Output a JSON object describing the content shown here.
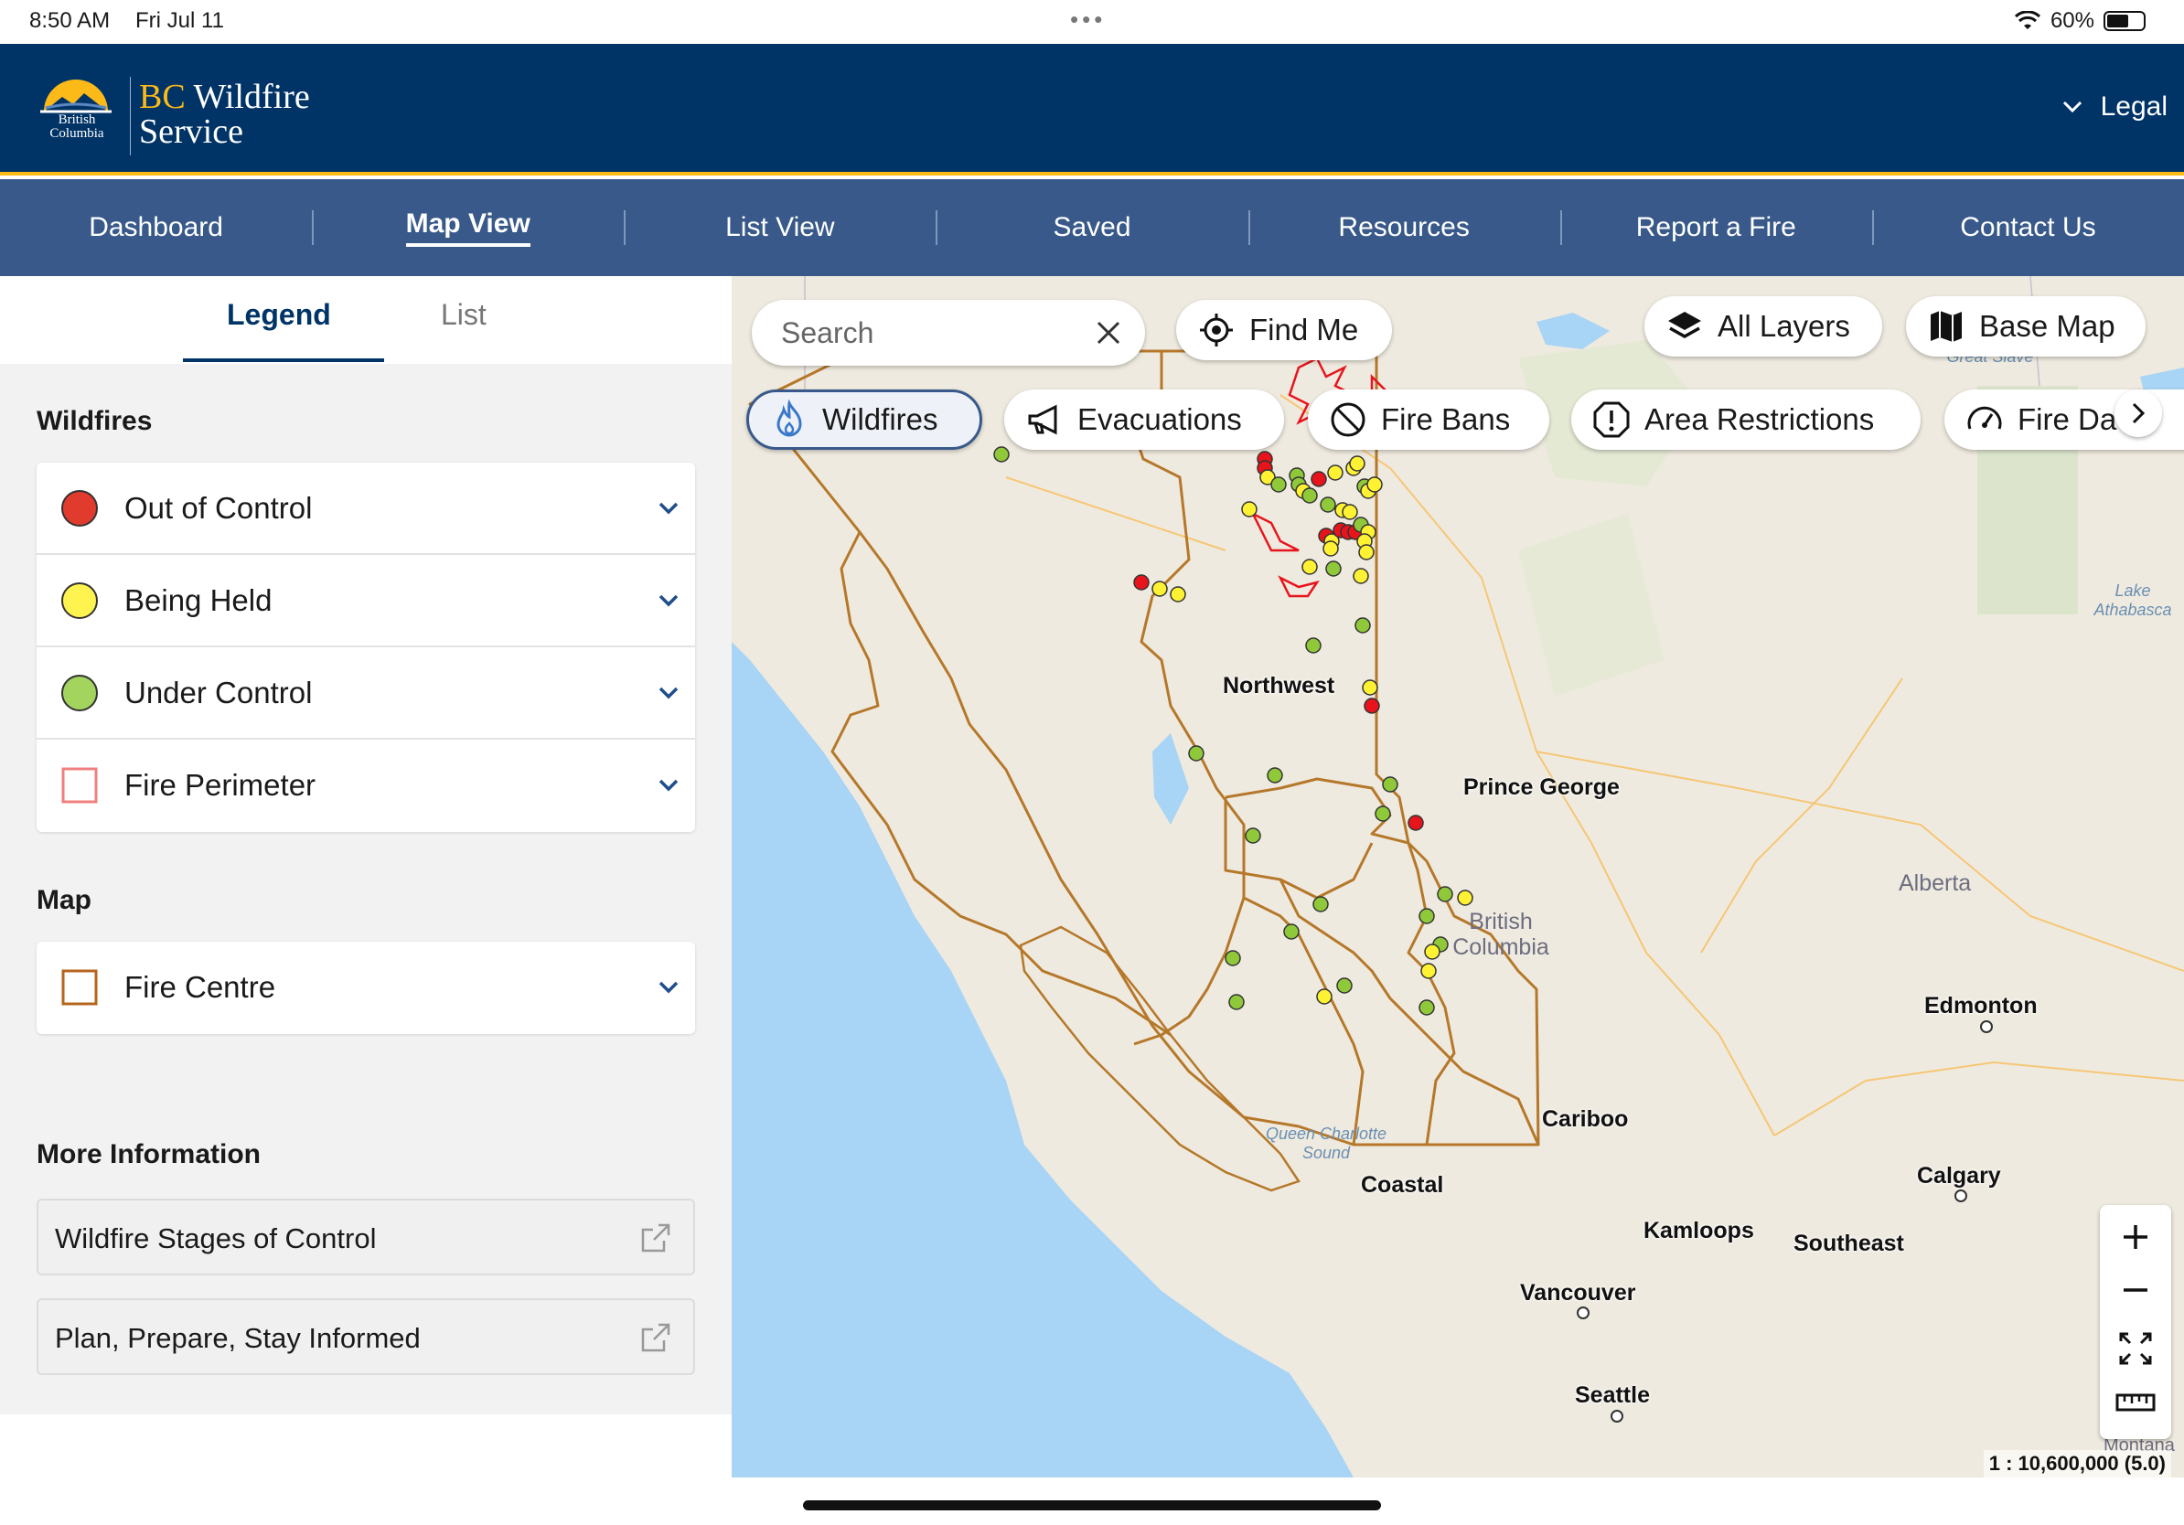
{
  "status_bar": {
    "time": "8:50 AM",
    "date": "Fri Jul 11",
    "battery": "60%",
    "battery_level": 0.6
  },
  "header": {
    "logo_small": "British Columbia",
    "logo_bc": "BC",
    "logo_title_rest": "Wildfire",
    "logo_title_line2": "Service",
    "legal_label": "Legal"
  },
  "nav": {
    "items": [
      "Dashboard",
      "Map View",
      "List View",
      "Saved",
      "Resources",
      "Report a Fire",
      "Contact Us"
    ],
    "active_index": 1
  },
  "panel": {
    "tabs": [
      "Legend",
      "List"
    ],
    "active_tab": 0,
    "wildfires_heading": "Wildfires",
    "wildfire_legend": [
      {
        "label": "Out of Control",
        "color": "#e03b2c",
        "symbol": "circle"
      },
      {
        "label": "Being Held",
        "color": "#fff44f",
        "symbol": "circle"
      },
      {
        "label": "Under Control",
        "color": "#a2d45e",
        "symbol": "circle"
      },
      {
        "label": "Fire Perimeter",
        "color": "#f08080",
        "symbol": "square-outline"
      }
    ],
    "map_heading": "Map",
    "map_legend": [
      {
        "label": "Fire Centre",
        "color": "#b5651d",
        "symbol": "square-outline"
      }
    ],
    "more_info_heading": "More Information",
    "more_info_links": [
      "Wildfire Stages of Control",
      "Plan, Prepare, Stay Informed"
    ]
  },
  "map": {
    "search_placeholder": "Search",
    "find_me": "Find Me",
    "all_layers": "All Layers",
    "base_map": "Base Map",
    "filters": [
      {
        "label": "Wildfires",
        "icon": "flame-icon",
        "active": true
      },
      {
        "label": "Evacuations",
        "icon": "megaphone-icon",
        "active": false
      },
      {
        "label": "Fire Bans",
        "icon": "ban-icon",
        "active": false
      },
      {
        "label": "Area Restrictions",
        "icon": "alert-icon",
        "active": false
      },
      {
        "label": "Fire Da",
        "icon": "gauge-icon",
        "active": false
      }
    ],
    "region_labels": {
      "northwest": "Northwest",
      "prince_george": "Prince George",
      "cariboo": "Cariboo",
      "coastal": "Coastal",
      "kamloops": "Kamloops",
      "southeast": "Southeast"
    },
    "place_labels": {
      "edmonton": "Edmonton",
      "calgary": "Calgary",
      "vancouver": "Vancouver",
      "seattle": "Seattle",
      "alberta": "Alberta",
      "british_columbia": "British Columbia",
      "lake_athabasca": "Lake Athabasca",
      "great_slave": "Great Slave",
      "queen_charlotte": "Queen Charlotte Sound",
      "montana": "Montana"
    },
    "scale_text": "1 : 10,600,000 (5.0)",
    "colors": {
      "out_of_control": "#e8141c",
      "being_held": "#fff233",
      "under_control": "#8fc93a",
      "fire_centre_border": "#b5782a",
      "land": "#efeadf",
      "water": "#a8d4f5"
    }
  }
}
